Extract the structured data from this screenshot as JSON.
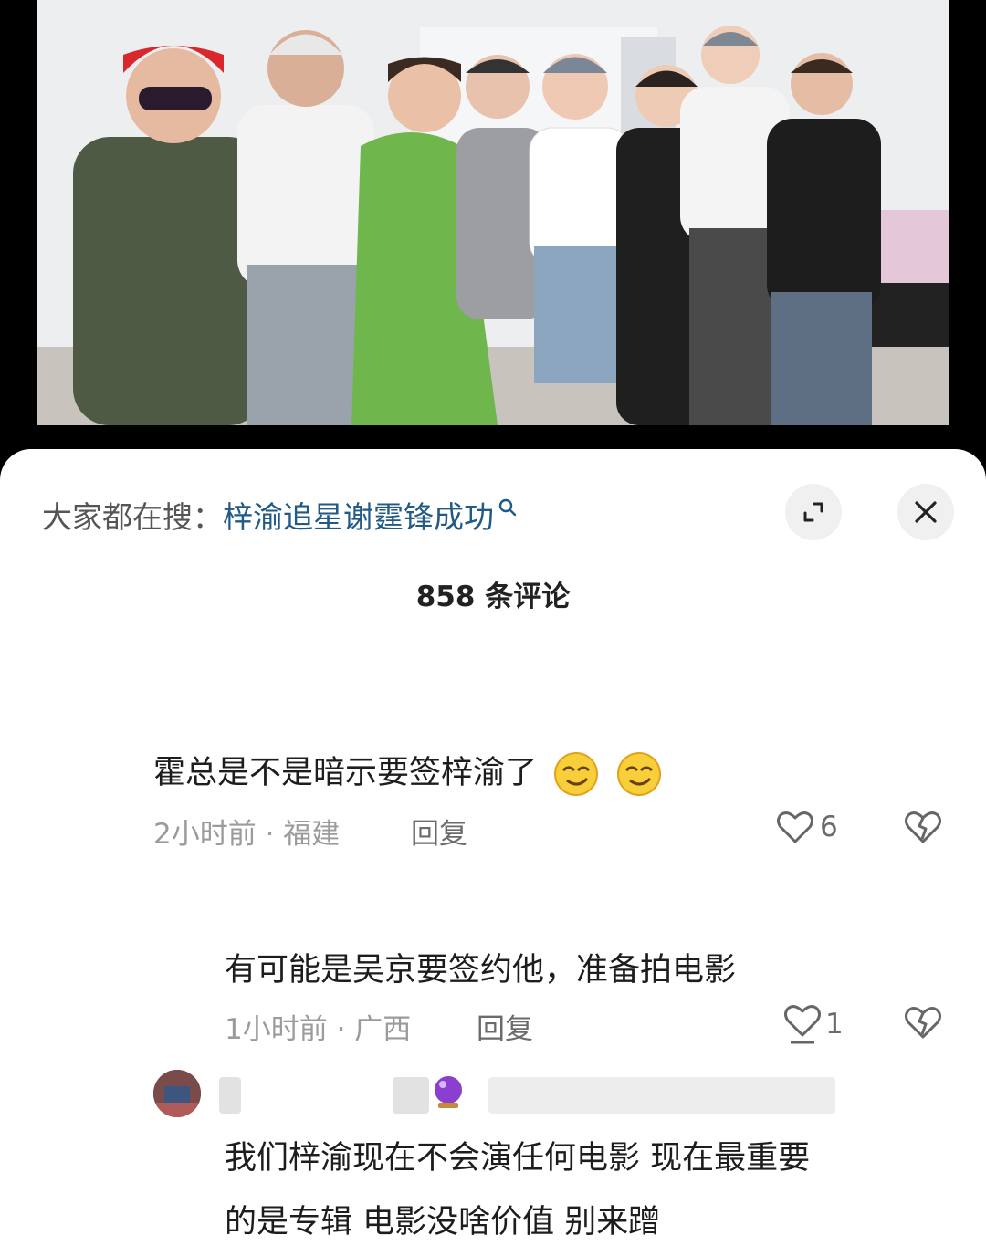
{
  "search": {
    "prefix": "大家都在搜：",
    "query": "梓渝追星谢霆锋成功"
  },
  "comments_header": {
    "title": "858 条评论"
  },
  "comments": [
    {
      "text": "霍总是不是暗示要签梓渝了",
      "time_location": "2小时前 · 福建",
      "reply_label": "回复",
      "likes": "6"
    },
    {
      "text": "有可能是吴京要签约他，准备拍电影",
      "time_location": "1小时前 · 广西",
      "reply_label": "回复",
      "likes": "1"
    },
    {
      "text_line1": "我们梓渝现在不会演任何电影 现在最重要",
      "text_line2": "的是专辑 电影没啥价值 别来蹭"
    }
  ],
  "colors": {
    "link": "#215a86",
    "meta": "#9b9b9b",
    "sheet_bg": "#ffffff"
  }
}
